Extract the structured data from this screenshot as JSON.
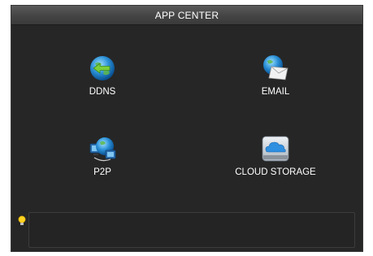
{
  "window": {
    "title": "APP CENTER"
  },
  "apps": [
    {
      "id": "ddns",
      "label": "DDNS",
      "icon": "globe-arrow-icon"
    },
    {
      "id": "email",
      "label": "EMAIL",
      "icon": "globe-envelope-icon"
    },
    {
      "id": "p2p",
      "label": "P2P",
      "icon": "globe-monitor-icon"
    },
    {
      "id": "cloud",
      "label": "CLOUD STORAGE",
      "icon": "cloud-drive-icon"
    }
  ],
  "tip": {
    "icon": "lightbulb-icon",
    "text": ""
  }
}
